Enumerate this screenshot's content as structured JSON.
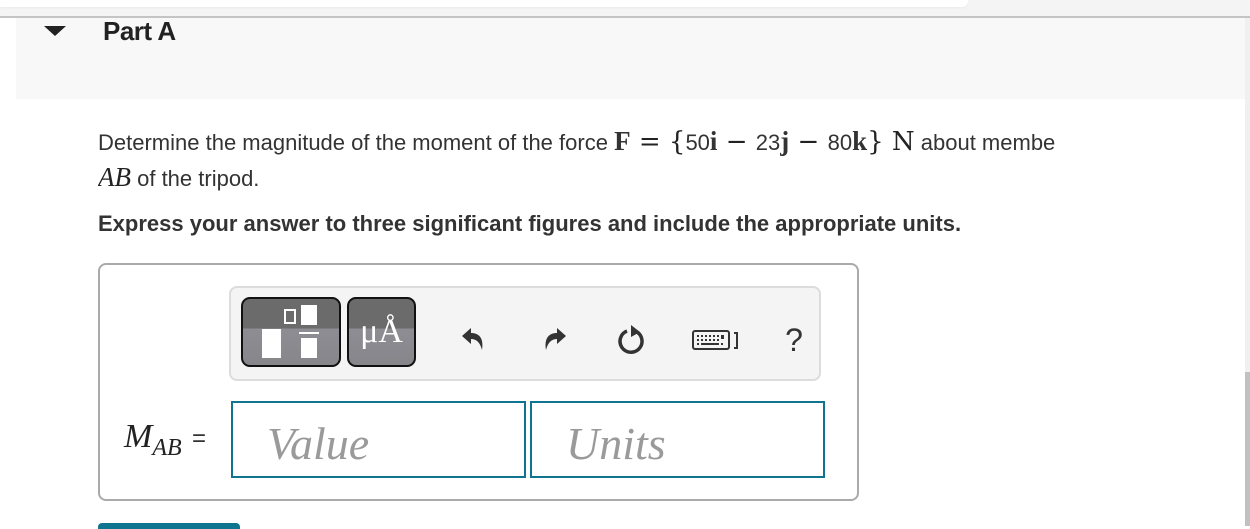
{
  "part": {
    "title": "Part A",
    "expanded": true
  },
  "question": {
    "text_prefix": "Determine the magnitude of the moment of the force ",
    "force_symbol": "F",
    "equals": " = ",
    "open_brace": "{",
    "i_coeff": "50",
    "i_unit": "i",
    "minus1": " − ",
    "j_coeff": "23",
    "j_unit": "j",
    "minus2": " − ",
    "k_coeff": "80",
    "k_unit": "k",
    "close_brace": "}",
    "unit": " N",
    "text_suffix": " about membe",
    "member": "AB",
    "text_line2": " of the tripod."
  },
  "instruction": "Express your answer to three significant figures and include the appropriate units.",
  "toolbar": {
    "templates_icon": "templates-icon",
    "units_label": "μÅ",
    "undo_icon": "undo-icon",
    "redo_icon": "redo-icon",
    "reset_icon": "reset-icon",
    "keyboard_icon": "keyboard-icon",
    "help_label": "?"
  },
  "answer": {
    "label_main": "M",
    "label_sub": "AB",
    "equals": "=",
    "value_placeholder": "Value",
    "value": "",
    "units_placeholder": "Units",
    "units": ""
  },
  "colors": {
    "input_border": "#0e7490",
    "accent": "#0e7490"
  }
}
